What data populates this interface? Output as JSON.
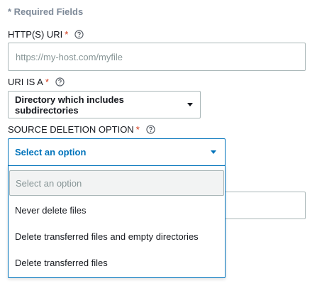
{
  "form": {
    "required_note": "* Required Fields",
    "uri": {
      "label": "HTTP(S) URI",
      "asterisk": "*",
      "placeholder": "https://my-host.com/myfile",
      "value": ""
    },
    "uri_is_a": {
      "label": "URI IS A",
      "asterisk": "*",
      "selected": "Directory which includes subdirectories"
    },
    "source_deletion": {
      "label": "SOURCE DELETION OPTION",
      "asterisk": "*",
      "selected": "Select an option",
      "dropdown": {
        "filter_placeholder": "Select an option",
        "options": [
          "Never delete files",
          "Delete transferred files and empty directories",
          "Delete transferred files"
        ]
      }
    }
  },
  "colors": {
    "accent": "#0073bb",
    "required": "#d13212",
    "muted": "#7d8998"
  }
}
